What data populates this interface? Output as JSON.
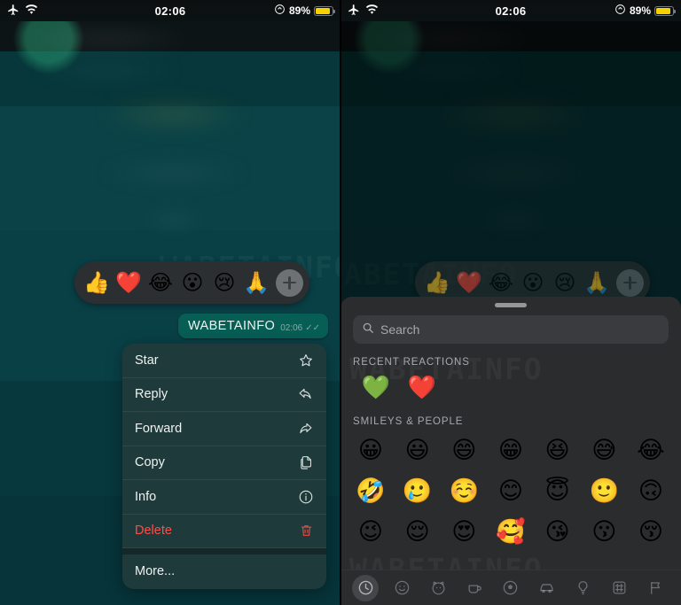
{
  "status_bar": {
    "airplane_icon": "airplane-icon",
    "wifi_icon": "wifi-icon",
    "time": "02:06",
    "lock_icon": "rotation-lock-icon",
    "battery_percent": "89%",
    "battery_level": 89
  },
  "left_panel": {
    "message": {
      "text": "WABETAINFO",
      "time": "02:06",
      "ticks": "✓✓"
    },
    "reaction_bar": {
      "emojis": [
        {
          "name": "thumbs-up",
          "glyph": "👍"
        },
        {
          "name": "red-heart",
          "glyph": "❤️"
        },
        {
          "name": "face-with-tears-of-joy",
          "glyph": "😂"
        },
        {
          "name": "face-with-open-mouth",
          "glyph": "😮"
        },
        {
          "name": "crying-face",
          "glyph": "😢"
        },
        {
          "name": "folded-hands",
          "glyph": "🙏"
        }
      ],
      "add_label": "+"
    },
    "context_menu": {
      "items": [
        {
          "label": "Star",
          "icon": "star-icon",
          "danger": false
        },
        {
          "label": "Reply",
          "icon": "reply-icon",
          "danger": false
        },
        {
          "label": "Forward",
          "icon": "forward-icon",
          "danger": false
        },
        {
          "label": "Copy",
          "icon": "copy-icon",
          "danger": false
        },
        {
          "label": "Info",
          "icon": "info-icon",
          "danger": false
        },
        {
          "label": "Delete",
          "icon": "trash-icon",
          "danger": true
        }
      ],
      "more_label": "More..."
    }
  },
  "right_panel": {
    "reaction_bar": {
      "emojis": [
        {
          "name": "thumbs-up",
          "glyph": "👍"
        },
        {
          "name": "red-heart",
          "glyph": "❤️"
        },
        {
          "name": "face-with-tears-of-joy",
          "glyph": "😂"
        },
        {
          "name": "face-with-open-mouth",
          "glyph": "😮"
        },
        {
          "name": "crying-face",
          "glyph": "😢"
        },
        {
          "name": "folded-hands",
          "glyph": "🙏"
        }
      ],
      "add_label": "+"
    },
    "emoji_picker": {
      "search_placeholder": "Search",
      "recent_title": "RECENT REACTIONS",
      "recent": [
        {
          "name": "green-heart",
          "glyph": "💚"
        },
        {
          "name": "red-heart",
          "glyph": "❤️"
        }
      ],
      "section_title": "SMILEYS & PEOPLE",
      "rows": [
        [
          {
            "name": "grinning-face",
            "glyph": "😀"
          },
          {
            "name": "grinning-face-with-big-eyes",
            "glyph": "😃"
          },
          {
            "name": "grinning-face-with-smiling-eyes",
            "glyph": "😄"
          },
          {
            "name": "beaming-face-with-smiling-eyes",
            "glyph": "😁"
          },
          {
            "name": "grinning-squinting-face",
            "glyph": "😆"
          },
          {
            "name": "grinning-face-with-sweat",
            "glyph": "😅"
          },
          {
            "name": "face-with-tears-of-joy",
            "glyph": "😂"
          }
        ],
        [
          {
            "name": "rolling-on-the-floor-laughing",
            "glyph": "🤣"
          },
          {
            "name": "smiling-face-with-tear",
            "glyph": "🥲"
          },
          {
            "name": "smiling-face",
            "glyph": "☺️"
          },
          {
            "name": "smiling-face-with-smiling-eyes",
            "glyph": "😊"
          },
          {
            "name": "smiling-face-with-halo",
            "glyph": "😇"
          },
          {
            "name": "slightly-smiling-face",
            "glyph": "🙂"
          },
          {
            "name": "upside-down-face",
            "glyph": "🙃"
          }
        ],
        [
          {
            "name": "winking-face",
            "glyph": "😉"
          },
          {
            "name": "relieved-face",
            "glyph": "😌"
          },
          {
            "name": "smiling-face-with-heart-eyes",
            "glyph": "😍"
          },
          {
            "name": "smiling-face-with-hearts",
            "glyph": "🥰"
          },
          {
            "name": "face-blowing-a-kiss",
            "glyph": "😘"
          },
          {
            "name": "kissing-face",
            "glyph": "😗"
          },
          {
            "name": "kissing-face-with-closed-eyes",
            "glyph": "😚"
          }
        ]
      ],
      "categories": [
        {
          "name": "recent-category",
          "icon": "clock-icon",
          "active": true
        },
        {
          "name": "smileys-category",
          "icon": "smiley-icon",
          "active": false
        },
        {
          "name": "animals-category",
          "icon": "animal-icon",
          "active": false
        },
        {
          "name": "food-category",
          "icon": "food-icon",
          "active": false
        },
        {
          "name": "activities-category",
          "icon": "activity-icon",
          "active": false
        },
        {
          "name": "travel-category",
          "icon": "car-icon",
          "active": false
        },
        {
          "name": "objects-category",
          "icon": "bulb-icon",
          "active": false
        },
        {
          "name": "symbols-category",
          "icon": "symbols-icon",
          "active": false
        },
        {
          "name": "flags-category",
          "icon": "flag-icon",
          "active": false
        }
      ]
    }
  },
  "watermark": {
    "text": "WABETAINFO"
  }
}
